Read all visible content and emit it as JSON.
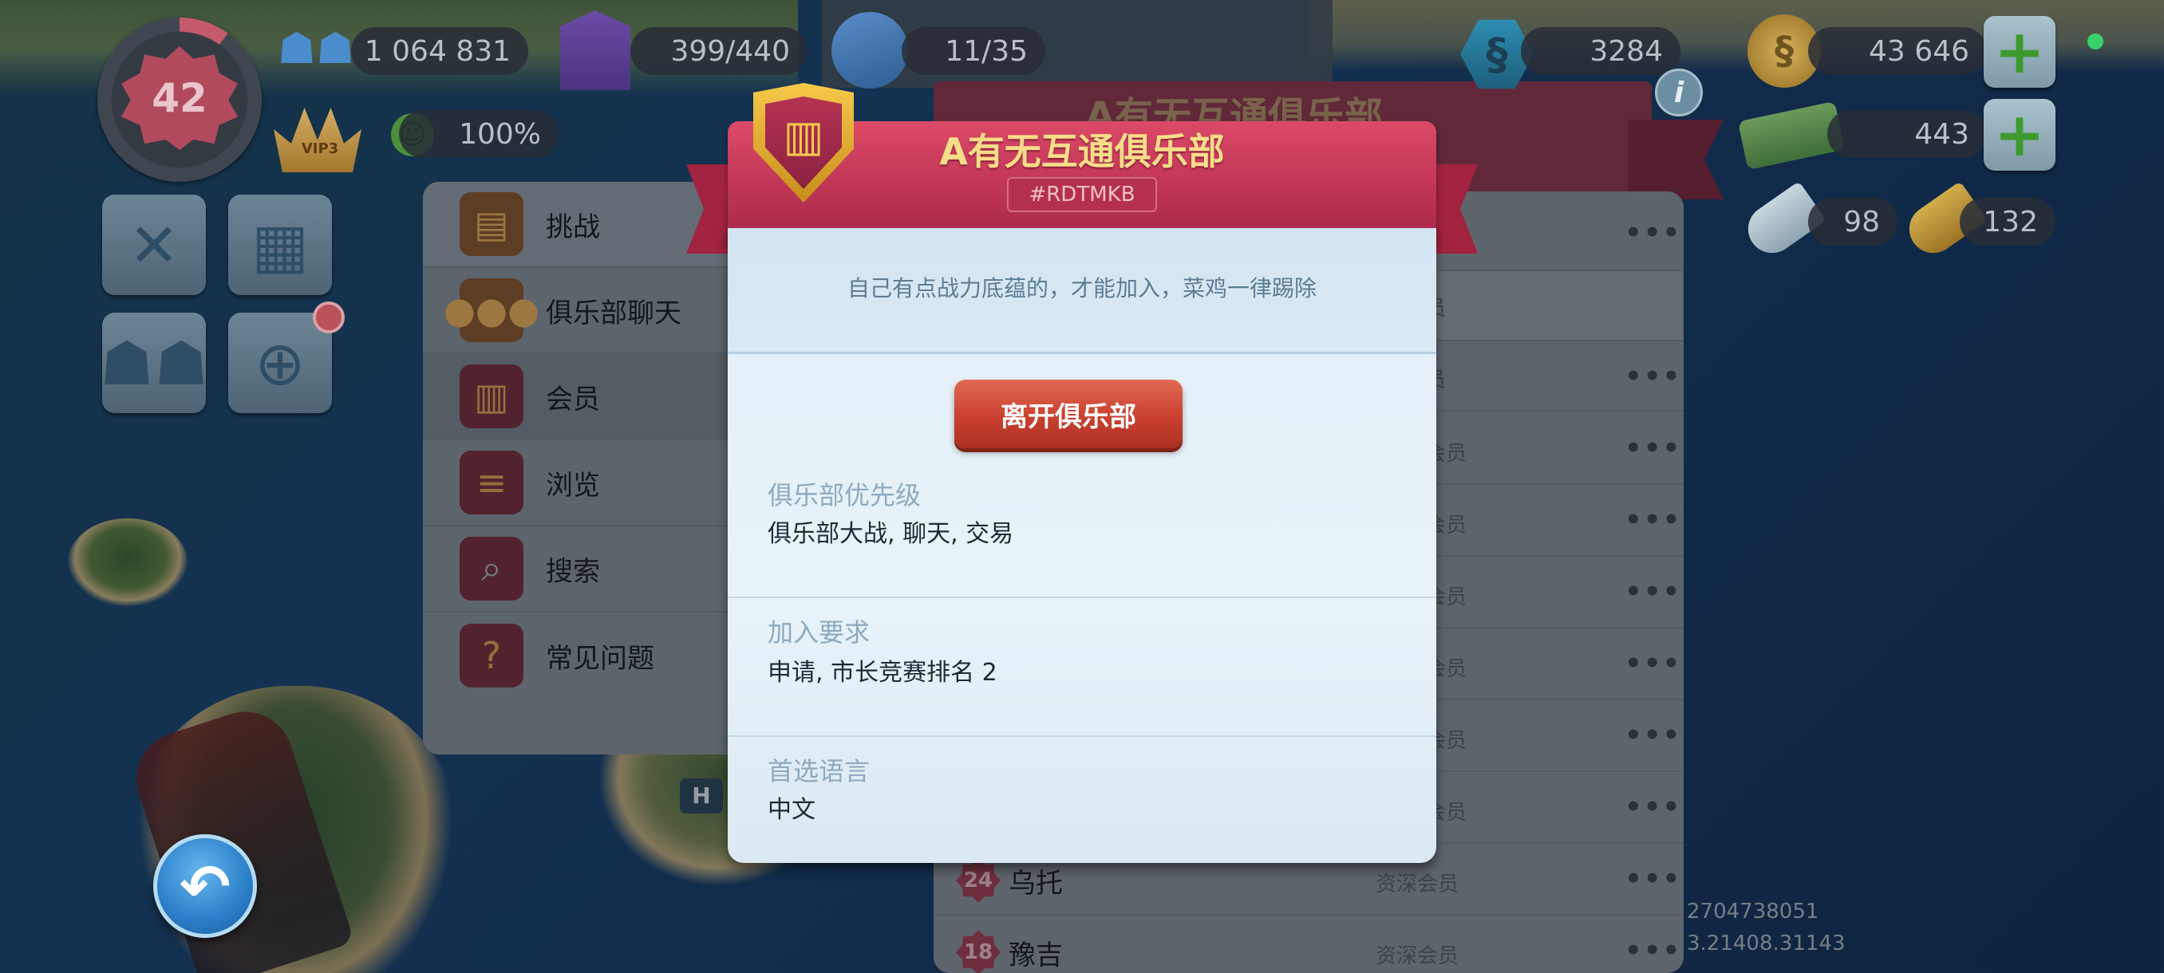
{
  "hud": {
    "level": "42",
    "population": "1 064 831",
    "storage": "399/440",
    "workers": "11/35",
    "simcash": "3284",
    "coins": "43 646",
    "money": "443",
    "happiness": "100%",
    "vip_label": "VIP3",
    "platinum_keys": "98",
    "golden_keys": "132"
  },
  "left_menu": {
    "items": [
      {
        "label": "挑战",
        "icon": "treasure-chest-icon"
      },
      {
        "label": "俱乐部聊天",
        "icon": "chat-bubble-icon"
      },
      {
        "label": "会员",
        "icon": "club-building-icon"
      },
      {
        "label": "浏览",
        "icon": "list-shield-icon"
      },
      {
        "label": "搜索",
        "icon": "search-shield-icon"
      },
      {
        "label": "常见问题",
        "icon": "faq-book-icon"
      }
    ]
  },
  "club_panel": {
    "title": "A有无互通俱乐部",
    "members": [
      {
        "level": "24",
        "name": "乌托",
        "role": "资深会员"
      },
      {
        "level": "18",
        "name": "豫吉",
        "role": "资深会员"
      }
    ],
    "partial_roles": [
      "员",
      "会员",
      "会员",
      "会员",
      "会员",
      "会员",
      "会员"
    ]
  },
  "version": {
    "line1": "2704738051",
    "line2": "3.21408.31143"
  },
  "modal": {
    "club_name": "A有无互通俱乐部",
    "club_tag": "#RDTMKB",
    "description": "自己有点战力底蕴的，才能加入，菜鸡一律踢除",
    "leave_button": "离开俱乐部",
    "fields": [
      {
        "label": "俱乐部优先级",
        "value": "俱乐部大战, 聊天, 交易"
      },
      {
        "label": "加入要求",
        "value": "申请, 市长竞赛排名 2"
      },
      {
        "label": "首选语言",
        "value": "中文"
      }
    ]
  },
  "colors": {
    "modal_header": "#c03556",
    "leave_button": "#c9402f",
    "title_gold": "#f7dd8a"
  }
}
